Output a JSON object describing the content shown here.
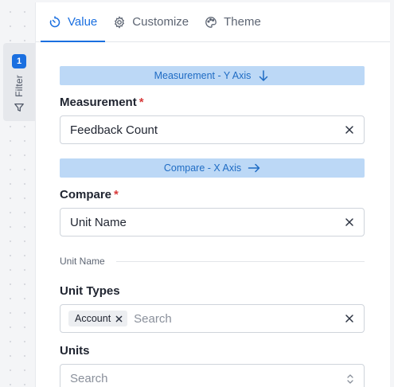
{
  "filter_tab": {
    "badge": "1",
    "label": "Filter"
  },
  "tabs": [
    {
      "label": "Value",
      "icon": "timer-icon",
      "active": true
    },
    {
      "label": "Customize",
      "icon": "gear-icon",
      "active": false
    },
    {
      "label": "Theme",
      "icon": "palette-icon",
      "active": false
    }
  ],
  "sections": {
    "measurement_banner": "Measurement - Y Axis",
    "compare_banner": "Compare - X Axis"
  },
  "fields": {
    "measurement": {
      "label": "Measurement",
      "required_mark": "*",
      "value": "Feedback Count"
    },
    "compare": {
      "label": "Compare",
      "required_mark": "*",
      "value": "Unit Name"
    },
    "divider": "Unit Name",
    "unit_types": {
      "label": "Unit Types",
      "chip": "Account",
      "placeholder": "Search"
    },
    "units": {
      "label": "Units",
      "placeholder": "Search"
    }
  },
  "colors": {
    "accent": "#1a6fe0",
    "banner_bg": "#bcd8f6",
    "required": "#d83a3a"
  }
}
